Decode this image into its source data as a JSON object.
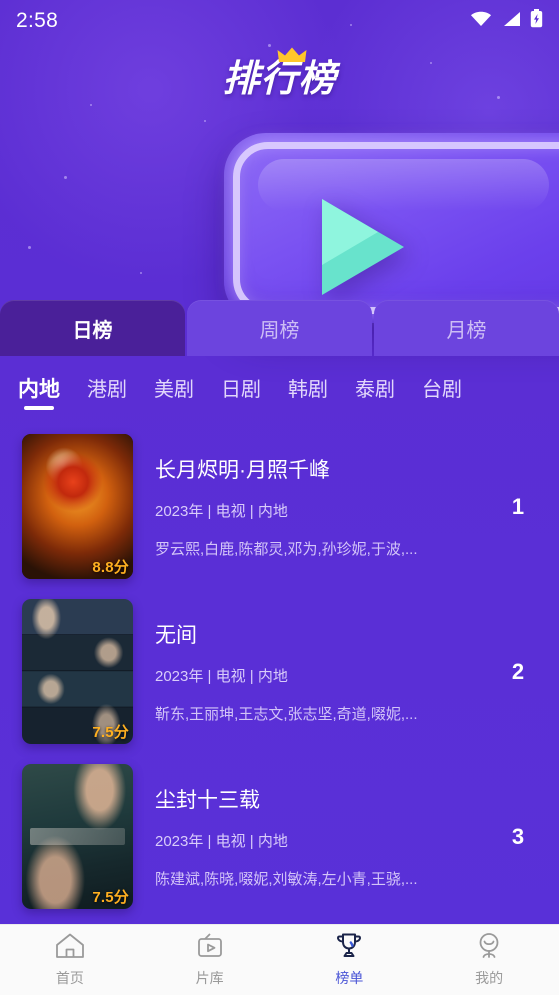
{
  "status_bar": {
    "time": "2:58",
    "icons": [
      "wifi-icon",
      "signal-icon",
      "battery-charging-icon"
    ]
  },
  "header": {
    "title": "排行榜",
    "hero_icon": "play-button-3d-icon",
    "crown_icon": "crown-icon"
  },
  "period_tabs": [
    {
      "label": "日榜",
      "active": true
    },
    {
      "label": "周榜",
      "active": false
    },
    {
      "label": "月榜",
      "active": false
    }
  ],
  "categories": [
    {
      "label": "内地",
      "active": true
    },
    {
      "label": "港剧",
      "active": false
    },
    {
      "label": "美剧",
      "active": false
    },
    {
      "label": "日剧",
      "active": false
    },
    {
      "label": "韩剧",
      "active": false
    },
    {
      "label": "泰剧",
      "active": false
    },
    {
      "label": "台剧",
      "active": false
    }
  ],
  "ranking_list": [
    {
      "rank": "1",
      "title": "长月烬明·月照千峰",
      "meta": "2023年 | 电视 | 内地",
      "cast": "罗云熙,白鹿,陈都灵,邓为,孙珍妮,于波,...",
      "score": "8.8分",
      "poster_style": "art-fire"
    },
    {
      "rank": "2",
      "title": "无间",
      "meta": "2023年 | 电视 | 内地",
      "cast": "靳东,王丽坤,王志文,张志坚,奇道,啜妮,...",
      "score": "7.5分",
      "poster_style": "art-bands"
    },
    {
      "rank": "3",
      "title": "尘封十三载",
      "meta": "2023年 | 电视 | 内地",
      "cast": "陈建斌,陈晓,啜妮,刘敏涛,左小青,王骁,...",
      "score": "7.5分",
      "poster_style": "art-dust"
    }
  ],
  "bottom_nav": [
    {
      "label": "首页",
      "icon": "home-icon",
      "active": false
    },
    {
      "label": "片库",
      "icon": "tv-library-icon",
      "active": false
    },
    {
      "label": "榜单",
      "icon": "trophy-icon",
      "active": true
    },
    {
      "label": "我的",
      "icon": "user-icon",
      "active": false
    }
  ],
  "colors": {
    "background_purple": "#5b2fd4",
    "tab_active_purple": "#4a2099",
    "tab_inactive_purple": "#6c44de",
    "score_orange": "#ffb020",
    "nav_active_blue": "#4a55d6",
    "play_triangle_teal": "#68e3cc",
    "crown_yellow": "#ffc62b"
  }
}
